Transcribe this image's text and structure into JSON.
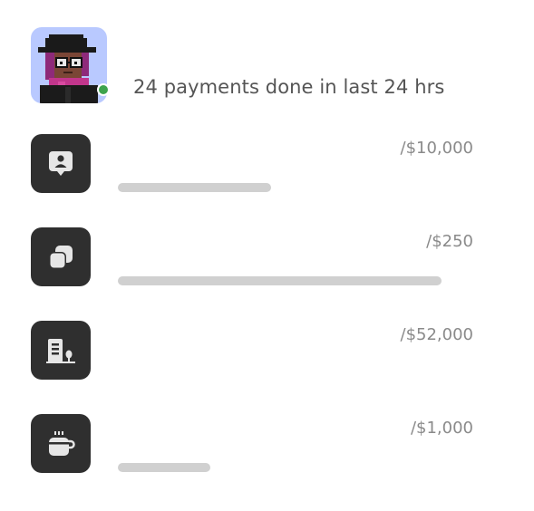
{
  "summary": {
    "text": "24 payments done in last 24 hrs",
    "status_color": "#3ea34d"
  },
  "payments": [
    {
      "icon": "contact-card-icon",
      "amount": "/$10,000",
      "progress": 0.43
    },
    {
      "icon": "layers-icon",
      "amount": "/$250",
      "progress": 0.91
    },
    {
      "icon": "building-tree-icon",
      "amount": "/$52,000",
      "progress": 0.0
    },
    {
      "icon": "coffee-cup-icon",
      "amount": "/$1,000",
      "progress": 0.26
    }
  ],
  "colors": {
    "icon_tile": "#2f2f2f",
    "icon_glyph": "#e6e6e6",
    "bar": "#d0d0d0",
    "amount_text": "#8a8a8a"
  }
}
